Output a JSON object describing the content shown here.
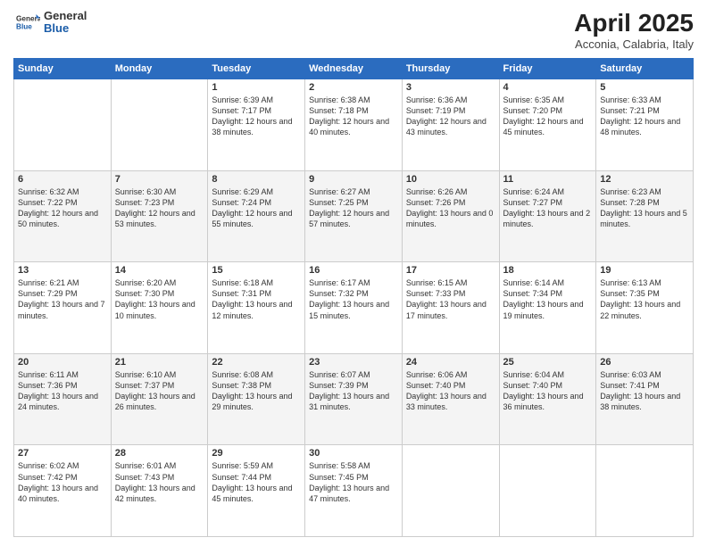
{
  "logo": {
    "line1": "General",
    "line2": "Blue"
  },
  "title": "April 2025",
  "subtitle": "Acconia, Calabria, Italy",
  "days_header": [
    "Sunday",
    "Monday",
    "Tuesday",
    "Wednesday",
    "Thursday",
    "Friday",
    "Saturday"
  ],
  "weeks": [
    [
      {
        "num": "",
        "info": ""
      },
      {
        "num": "",
        "info": ""
      },
      {
        "num": "1",
        "info": "Sunrise: 6:39 AM\nSunset: 7:17 PM\nDaylight: 12 hours and 38 minutes."
      },
      {
        "num": "2",
        "info": "Sunrise: 6:38 AM\nSunset: 7:18 PM\nDaylight: 12 hours and 40 minutes."
      },
      {
        "num": "3",
        "info": "Sunrise: 6:36 AM\nSunset: 7:19 PM\nDaylight: 12 hours and 43 minutes."
      },
      {
        "num": "4",
        "info": "Sunrise: 6:35 AM\nSunset: 7:20 PM\nDaylight: 12 hours and 45 minutes."
      },
      {
        "num": "5",
        "info": "Sunrise: 6:33 AM\nSunset: 7:21 PM\nDaylight: 12 hours and 48 minutes."
      }
    ],
    [
      {
        "num": "6",
        "info": "Sunrise: 6:32 AM\nSunset: 7:22 PM\nDaylight: 12 hours and 50 minutes."
      },
      {
        "num": "7",
        "info": "Sunrise: 6:30 AM\nSunset: 7:23 PM\nDaylight: 12 hours and 53 minutes."
      },
      {
        "num": "8",
        "info": "Sunrise: 6:29 AM\nSunset: 7:24 PM\nDaylight: 12 hours and 55 minutes."
      },
      {
        "num": "9",
        "info": "Sunrise: 6:27 AM\nSunset: 7:25 PM\nDaylight: 12 hours and 57 minutes."
      },
      {
        "num": "10",
        "info": "Sunrise: 6:26 AM\nSunset: 7:26 PM\nDaylight: 13 hours and 0 minutes."
      },
      {
        "num": "11",
        "info": "Sunrise: 6:24 AM\nSunset: 7:27 PM\nDaylight: 13 hours and 2 minutes."
      },
      {
        "num": "12",
        "info": "Sunrise: 6:23 AM\nSunset: 7:28 PM\nDaylight: 13 hours and 5 minutes."
      }
    ],
    [
      {
        "num": "13",
        "info": "Sunrise: 6:21 AM\nSunset: 7:29 PM\nDaylight: 13 hours and 7 minutes."
      },
      {
        "num": "14",
        "info": "Sunrise: 6:20 AM\nSunset: 7:30 PM\nDaylight: 13 hours and 10 minutes."
      },
      {
        "num": "15",
        "info": "Sunrise: 6:18 AM\nSunset: 7:31 PM\nDaylight: 13 hours and 12 minutes."
      },
      {
        "num": "16",
        "info": "Sunrise: 6:17 AM\nSunset: 7:32 PM\nDaylight: 13 hours and 15 minutes."
      },
      {
        "num": "17",
        "info": "Sunrise: 6:15 AM\nSunset: 7:33 PM\nDaylight: 13 hours and 17 minutes."
      },
      {
        "num": "18",
        "info": "Sunrise: 6:14 AM\nSunset: 7:34 PM\nDaylight: 13 hours and 19 minutes."
      },
      {
        "num": "19",
        "info": "Sunrise: 6:13 AM\nSunset: 7:35 PM\nDaylight: 13 hours and 22 minutes."
      }
    ],
    [
      {
        "num": "20",
        "info": "Sunrise: 6:11 AM\nSunset: 7:36 PM\nDaylight: 13 hours and 24 minutes."
      },
      {
        "num": "21",
        "info": "Sunrise: 6:10 AM\nSunset: 7:37 PM\nDaylight: 13 hours and 26 minutes."
      },
      {
        "num": "22",
        "info": "Sunrise: 6:08 AM\nSunset: 7:38 PM\nDaylight: 13 hours and 29 minutes."
      },
      {
        "num": "23",
        "info": "Sunrise: 6:07 AM\nSunset: 7:39 PM\nDaylight: 13 hours and 31 minutes."
      },
      {
        "num": "24",
        "info": "Sunrise: 6:06 AM\nSunset: 7:40 PM\nDaylight: 13 hours and 33 minutes."
      },
      {
        "num": "25",
        "info": "Sunrise: 6:04 AM\nSunset: 7:40 PM\nDaylight: 13 hours and 36 minutes."
      },
      {
        "num": "26",
        "info": "Sunrise: 6:03 AM\nSunset: 7:41 PM\nDaylight: 13 hours and 38 minutes."
      }
    ],
    [
      {
        "num": "27",
        "info": "Sunrise: 6:02 AM\nSunset: 7:42 PM\nDaylight: 13 hours and 40 minutes."
      },
      {
        "num": "28",
        "info": "Sunrise: 6:01 AM\nSunset: 7:43 PM\nDaylight: 13 hours and 42 minutes."
      },
      {
        "num": "29",
        "info": "Sunrise: 5:59 AM\nSunset: 7:44 PM\nDaylight: 13 hours and 45 minutes."
      },
      {
        "num": "30",
        "info": "Sunrise: 5:58 AM\nSunset: 7:45 PM\nDaylight: 13 hours and 47 minutes."
      },
      {
        "num": "",
        "info": ""
      },
      {
        "num": "",
        "info": ""
      },
      {
        "num": "",
        "info": ""
      }
    ]
  ]
}
